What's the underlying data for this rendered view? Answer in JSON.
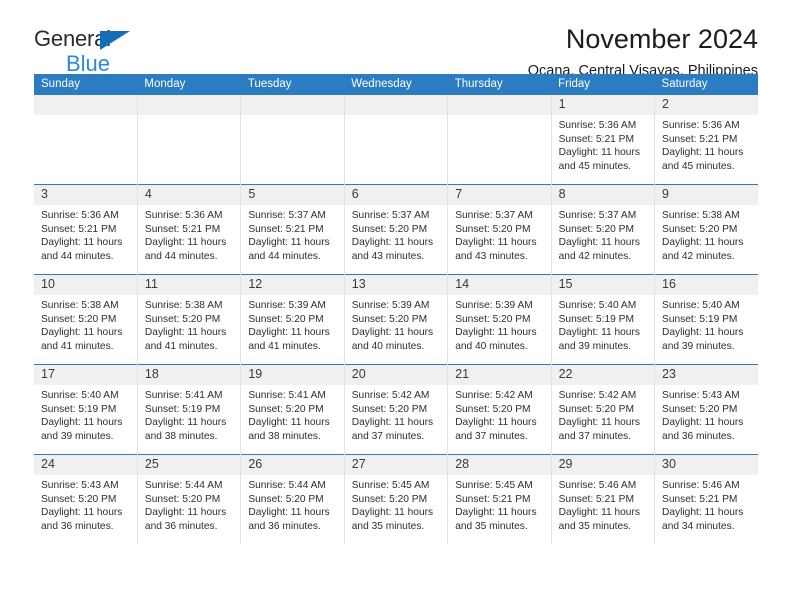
{
  "brand": {
    "line1": "General",
    "line2": "Blue",
    "triangle_color": "#1370b8",
    "line2_color": "#2b8ada"
  },
  "header": {
    "title": "November 2024",
    "location": "Ocana, Central Visayas, Philippines"
  },
  "theme": {
    "header_blue": "#2b7cc0",
    "daynum_band": "#f0f0f0",
    "cell_border": "#e2e2e2"
  },
  "weekdays": [
    "Sunday",
    "Monday",
    "Tuesday",
    "Wednesday",
    "Thursday",
    "Friday",
    "Saturday"
  ],
  "labels": {
    "sunrise": "Sunrise:",
    "sunset": "Sunset:",
    "daylight": "Daylight:"
  },
  "weeks": [
    [
      {
        "day": "",
        "empty": true
      },
      {
        "day": "",
        "empty": true
      },
      {
        "day": "",
        "empty": true
      },
      {
        "day": "",
        "empty": true
      },
      {
        "day": "",
        "empty": true
      },
      {
        "day": "1",
        "sunrise": "Sunrise: 5:36 AM",
        "sunset": "Sunset: 5:21 PM",
        "daylight": "Daylight: 11 hours and 45 minutes."
      },
      {
        "day": "2",
        "sunrise": "Sunrise: 5:36 AM",
        "sunset": "Sunset: 5:21 PM",
        "daylight": "Daylight: 11 hours and 45 minutes."
      }
    ],
    [
      {
        "day": "3",
        "sunrise": "Sunrise: 5:36 AM",
        "sunset": "Sunset: 5:21 PM",
        "daylight": "Daylight: 11 hours and 44 minutes."
      },
      {
        "day": "4",
        "sunrise": "Sunrise: 5:36 AM",
        "sunset": "Sunset: 5:21 PM",
        "daylight": "Daylight: 11 hours and 44 minutes."
      },
      {
        "day": "5",
        "sunrise": "Sunrise: 5:37 AM",
        "sunset": "Sunset: 5:21 PM",
        "daylight": "Daylight: 11 hours and 44 minutes."
      },
      {
        "day": "6",
        "sunrise": "Sunrise: 5:37 AM",
        "sunset": "Sunset: 5:20 PM",
        "daylight": "Daylight: 11 hours and 43 minutes."
      },
      {
        "day": "7",
        "sunrise": "Sunrise: 5:37 AM",
        "sunset": "Sunset: 5:20 PM",
        "daylight": "Daylight: 11 hours and 43 minutes."
      },
      {
        "day": "8",
        "sunrise": "Sunrise: 5:37 AM",
        "sunset": "Sunset: 5:20 PM",
        "daylight": "Daylight: 11 hours and 42 minutes."
      },
      {
        "day": "9",
        "sunrise": "Sunrise: 5:38 AM",
        "sunset": "Sunset: 5:20 PM",
        "daylight": "Daylight: 11 hours and 42 minutes."
      }
    ],
    [
      {
        "day": "10",
        "sunrise": "Sunrise: 5:38 AM",
        "sunset": "Sunset: 5:20 PM",
        "daylight": "Daylight: 11 hours and 41 minutes."
      },
      {
        "day": "11",
        "sunrise": "Sunrise: 5:38 AM",
        "sunset": "Sunset: 5:20 PM",
        "daylight": "Daylight: 11 hours and 41 minutes."
      },
      {
        "day": "12",
        "sunrise": "Sunrise: 5:39 AM",
        "sunset": "Sunset: 5:20 PM",
        "daylight": "Daylight: 11 hours and 41 minutes."
      },
      {
        "day": "13",
        "sunrise": "Sunrise: 5:39 AM",
        "sunset": "Sunset: 5:20 PM",
        "daylight": "Daylight: 11 hours and 40 minutes."
      },
      {
        "day": "14",
        "sunrise": "Sunrise: 5:39 AM",
        "sunset": "Sunset: 5:20 PM",
        "daylight": "Daylight: 11 hours and 40 minutes."
      },
      {
        "day": "15",
        "sunrise": "Sunrise: 5:40 AM",
        "sunset": "Sunset: 5:19 PM",
        "daylight": "Daylight: 11 hours and 39 minutes."
      },
      {
        "day": "16",
        "sunrise": "Sunrise: 5:40 AM",
        "sunset": "Sunset: 5:19 PM",
        "daylight": "Daylight: 11 hours and 39 minutes."
      }
    ],
    [
      {
        "day": "17",
        "sunrise": "Sunrise: 5:40 AM",
        "sunset": "Sunset: 5:19 PM",
        "daylight": "Daylight: 11 hours and 39 minutes."
      },
      {
        "day": "18",
        "sunrise": "Sunrise: 5:41 AM",
        "sunset": "Sunset: 5:19 PM",
        "daylight": "Daylight: 11 hours and 38 minutes."
      },
      {
        "day": "19",
        "sunrise": "Sunrise: 5:41 AM",
        "sunset": "Sunset: 5:20 PM",
        "daylight": "Daylight: 11 hours and 38 minutes."
      },
      {
        "day": "20",
        "sunrise": "Sunrise: 5:42 AM",
        "sunset": "Sunset: 5:20 PM",
        "daylight": "Daylight: 11 hours and 37 minutes."
      },
      {
        "day": "21",
        "sunrise": "Sunrise: 5:42 AM",
        "sunset": "Sunset: 5:20 PM",
        "daylight": "Daylight: 11 hours and 37 minutes."
      },
      {
        "day": "22",
        "sunrise": "Sunrise: 5:42 AM",
        "sunset": "Sunset: 5:20 PM",
        "daylight": "Daylight: 11 hours and 37 minutes."
      },
      {
        "day": "23",
        "sunrise": "Sunrise: 5:43 AM",
        "sunset": "Sunset: 5:20 PM",
        "daylight": "Daylight: 11 hours and 36 minutes."
      }
    ],
    [
      {
        "day": "24",
        "sunrise": "Sunrise: 5:43 AM",
        "sunset": "Sunset: 5:20 PM",
        "daylight": "Daylight: 11 hours and 36 minutes."
      },
      {
        "day": "25",
        "sunrise": "Sunrise: 5:44 AM",
        "sunset": "Sunset: 5:20 PM",
        "daylight": "Daylight: 11 hours and 36 minutes."
      },
      {
        "day": "26",
        "sunrise": "Sunrise: 5:44 AM",
        "sunset": "Sunset: 5:20 PM",
        "daylight": "Daylight: 11 hours and 36 minutes."
      },
      {
        "day": "27",
        "sunrise": "Sunrise: 5:45 AM",
        "sunset": "Sunset: 5:20 PM",
        "daylight": "Daylight: 11 hours and 35 minutes."
      },
      {
        "day": "28",
        "sunrise": "Sunrise: 5:45 AM",
        "sunset": "Sunset: 5:21 PM",
        "daylight": "Daylight: 11 hours and 35 minutes."
      },
      {
        "day": "29",
        "sunrise": "Sunrise: 5:46 AM",
        "sunset": "Sunset: 5:21 PM",
        "daylight": "Daylight: 11 hours and 35 minutes."
      },
      {
        "day": "30",
        "sunrise": "Sunrise: 5:46 AM",
        "sunset": "Sunset: 5:21 PM",
        "daylight": "Daylight: 11 hours and 34 minutes."
      }
    ]
  ]
}
